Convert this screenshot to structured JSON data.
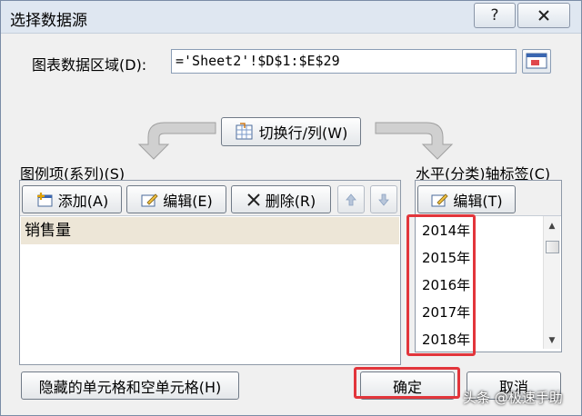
{
  "window": {
    "title": "选择数据源",
    "help_label": "?"
  },
  "data_range": {
    "label": "图表数据区域(D):",
    "value": "='Sheet2'!$D$1:$E$29"
  },
  "switch_button": {
    "label": "切换行/列(W)"
  },
  "series_panel": {
    "label": "图例项(系列)(S)",
    "add_label": "添加(A)",
    "edit_label": "编辑(E)",
    "delete_label": "删除(R)",
    "items": [
      "销售量"
    ]
  },
  "category_panel": {
    "label": "水平(分类)轴标签(C)",
    "edit_label": "编辑(T)",
    "items": [
      "2014年",
      "2015年",
      "2016年",
      "2017年",
      "2018年"
    ]
  },
  "footer": {
    "hidden_cells_label": "隐藏的单元格和空单元格(H)",
    "ok_label": "确定",
    "cancel_label": "取消"
  },
  "watermark": "头条 @极速手助",
  "colors": {
    "highlight": "#e2353b",
    "selected_series": "#ede6d7",
    "dialog_bg": "#f0f0f0"
  }
}
